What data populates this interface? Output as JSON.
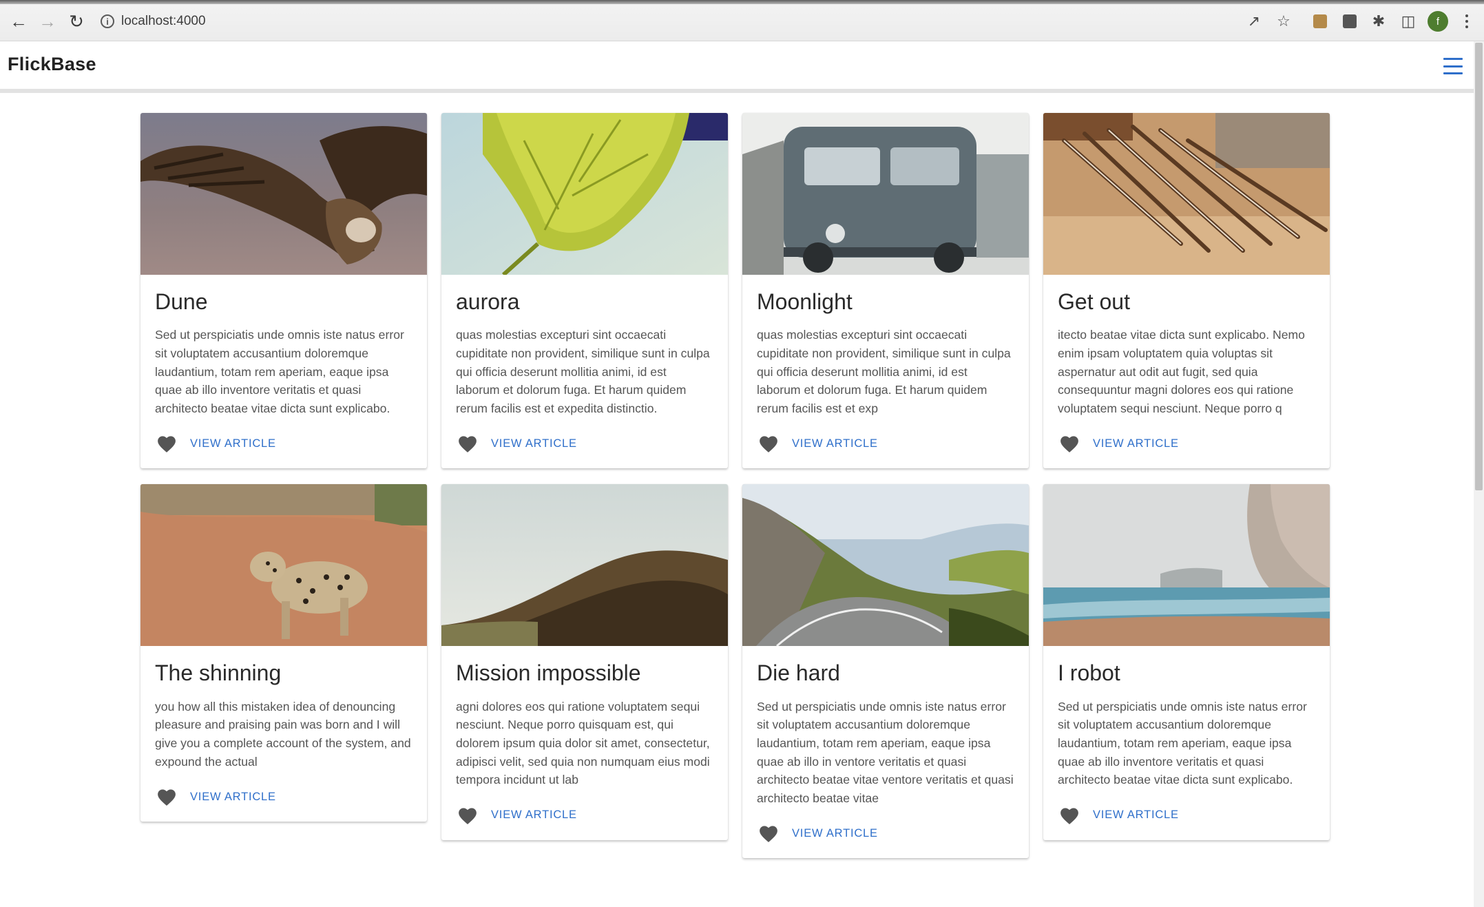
{
  "browser": {
    "url": "localhost:4000",
    "profile_initial": "f"
  },
  "header": {
    "brand": "FlickBase"
  },
  "colors": {
    "accent": "#2f6fca",
    "heart": "#555555"
  },
  "articles": [
    {
      "title": "Dune",
      "excerpt": "Sed ut perspiciatis unde omnis iste natus error sit voluptatem accusantium doloremque laudantium, totam rem aperiam, eaque ipsa quae ab illo inventore veritatis et quasi architecto beatae vitae dicta sunt explicabo.",
      "action": "VIEW ARTICLE",
      "image": "vulture"
    },
    {
      "title": "aurora",
      "excerpt": "quas molestias excepturi sint occaecati cupiditate non provident, similique sunt in culpa qui officia deserunt mollitia animi, id est laborum et dolorum fuga. Et harum quidem rerum facilis est et expedita distinctio.",
      "action": "VIEW ARTICLE",
      "image": "leaf"
    },
    {
      "title": "Moonlight",
      "excerpt": "quas molestias excepturi sint occaecati cupiditate non provident, similique sunt in culpa qui officia deserunt mollitia animi, id est laborum et dolorum fuga. Et harum quidem rerum facilis est et exp",
      "action": "VIEW ARTICLE",
      "image": "van"
    },
    {
      "title": "Get out",
      "excerpt": "itecto beatae vitae dicta sunt explicabo. Nemo enim ipsam voluptatem quia voluptas sit aspernatur aut odit aut fugit, sed quia consequuntur magni dolores eos qui ratione voluptatem sequi nesciunt. Neque porro q",
      "action": "VIEW ARTICLE",
      "image": "pens"
    },
    {
      "title": "The shinning",
      "excerpt": "you how all this mistaken idea of denouncing pleasure and praising pain was born and I will give you a complete account of the system, and expound the actual",
      "action": "VIEW ARTICLE",
      "image": "leopard"
    },
    {
      "title": "Mission impossible",
      "excerpt": "agni dolores eos qui ratione voluptatem sequi nesciunt. Neque porro quisquam est, qui dolorem ipsum quia dolor sit amet, consectetur, adipisci velit, sed quia non numquam eius modi tempora incidunt ut lab",
      "action": "VIEW ARTICLE",
      "image": "hill"
    },
    {
      "title": "Die hard",
      "excerpt": "Sed ut perspiciatis unde omnis iste natus error sit voluptatem accusantium doloremque laudantium, totam rem aperiam, eaque ipsa quae ab illo in ventore veritatis et quasi architecto beatae vitae ventore veritatis et quasi architecto beatae vitae",
      "action": "VIEW ARTICLE",
      "image": "mountain-road"
    },
    {
      "title": "I robot",
      "excerpt": "Sed ut perspiciatis unde omnis iste natus error sit voluptatem accusantium doloremque laudantium, totam rem aperiam, eaque ipsa quae ab illo inventore veritatis et quasi architecto beatae vitae dicta sunt explicabo.",
      "action": "VIEW ARTICLE",
      "image": "sea-cliff"
    }
  ]
}
